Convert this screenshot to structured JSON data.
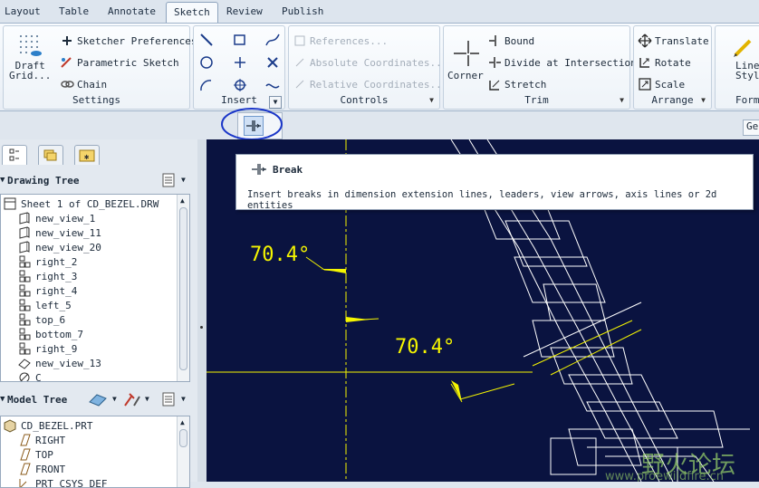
{
  "tabs": [
    {
      "label": "Layout",
      "name": "tab-layout"
    },
    {
      "label": "Table",
      "name": "tab-table"
    },
    {
      "label": "Annotate",
      "name": "tab-annotate"
    },
    {
      "label": "Sketch",
      "name": "tab-sketch",
      "active": true
    },
    {
      "label": "Review",
      "name": "tab-review"
    },
    {
      "label": "Publish",
      "name": "tab-publish"
    }
  ],
  "ribbon": {
    "settings": {
      "label": "Settings",
      "draft_grid_line1": "Draft",
      "draft_grid_line2": "Grid...",
      "sketcher_preferences": "Sketcher Preferences",
      "parametric_sketch": "Parametric Sketch",
      "chain": "Chain"
    },
    "insert": {
      "label": "Insert"
    },
    "controls": {
      "label": "Controls",
      "references": "References...",
      "absolute_coordinates": "Absolute Coordinates...",
      "relative_coordinates": "Relative Coordinates..."
    },
    "trim": {
      "label": "Trim",
      "corner": "Corner",
      "bound": "Bound",
      "divide_at_intersection": "Divide at Intersection",
      "stretch": "Stretch"
    },
    "arrange": {
      "label": "Arrange",
      "translate": "Translate",
      "rotate": "Rotate",
      "scale": "Scale"
    },
    "format": {
      "label": "Form",
      "line_style_line1": "Line",
      "line_style_line2": "Style"
    }
  },
  "subbar": {
    "ge_label": "Ge"
  },
  "tooltip": {
    "title": "Break",
    "description": "Insert breaks in dimension extension lines, leaders, view arrows, axis lines or 2d entities"
  },
  "drawing_tree": {
    "header": "Drawing Tree",
    "items": [
      {
        "label": "Sheet 1 of CD_BEZEL.DRW",
        "icon": "sheet-icon",
        "indent": 0
      },
      {
        "label": "new_view_1",
        "icon": "general-view-icon",
        "indent": 1
      },
      {
        "label": "new_view_11",
        "icon": "general-view-icon",
        "indent": 1
      },
      {
        "label": "new_view_20",
        "icon": "general-view-icon",
        "indent": 1
      },
      {
        "label": "right_2",
        "icon": "projection-view-icon",
        "indent": 1
      },
      {
        "label": "right_3",
        "icon": "projection-view-icon",
        "indent": 1
      },
      {
        "label": "right_4",
        "icon": "projection-view-icon",
        "indent": 1
      },
      {
        "label": "left_5",
        "icon": "projection-view-icon",
        "indent": 1
      },
      {
        "label": "top_6",
        "icon": "projection-view-icon",
        "indent": 1
      },
      {
        "label": "bottom_7",
        "icon": "projection-view-icon",
        "indent": 1
      },
      {
        "label": "right_9",
        "icon": "projection-view-icon",
        "indent": 1
      },
      {
        "label": "new_view_13",
        "icon": "detail-view-icon",
        "indent": 1
      },
      {
        "label": "C",
        "icon": "section-view-icon",
        "indent": 1
      }
    ]
  },
  "model_tree": {
    "header": "Model Tree",
    "items": [
      {
        "label": "CD_BEZEL.PRT",
        "icon": "part-icon",
        "indent": 0
      },
      {
        "label": "RIGHT",
        "icon": "datum-plane-icon",
        "indent": 1
      },
      {
        "label": "TOP",
        "icon": "datum-plane-icon",
        "indent": 1
      },
      {
        "label": "FRONT",
        "icon": "datum-plane-icon",
        "indent": 1
      },
      {
        "label": "PRT_CSYS_DEF",
        "icon": "csys-icon",
        "indent": 1
      }
    ]
  },
  "canvas": {
    "dim1": "70.4°",
    "dim2": "70.4°",
    "watermark_text": "野火论坛",
    "watermark_url": "www.proewildfire.cn"
  },
  "colors": {
    "canvas_bg": "#0a1340",
    "dimension": "#f5f500",
    "geometry": "#ffffff",
    "highlight_circle": "#1a36c8"
  }
}
